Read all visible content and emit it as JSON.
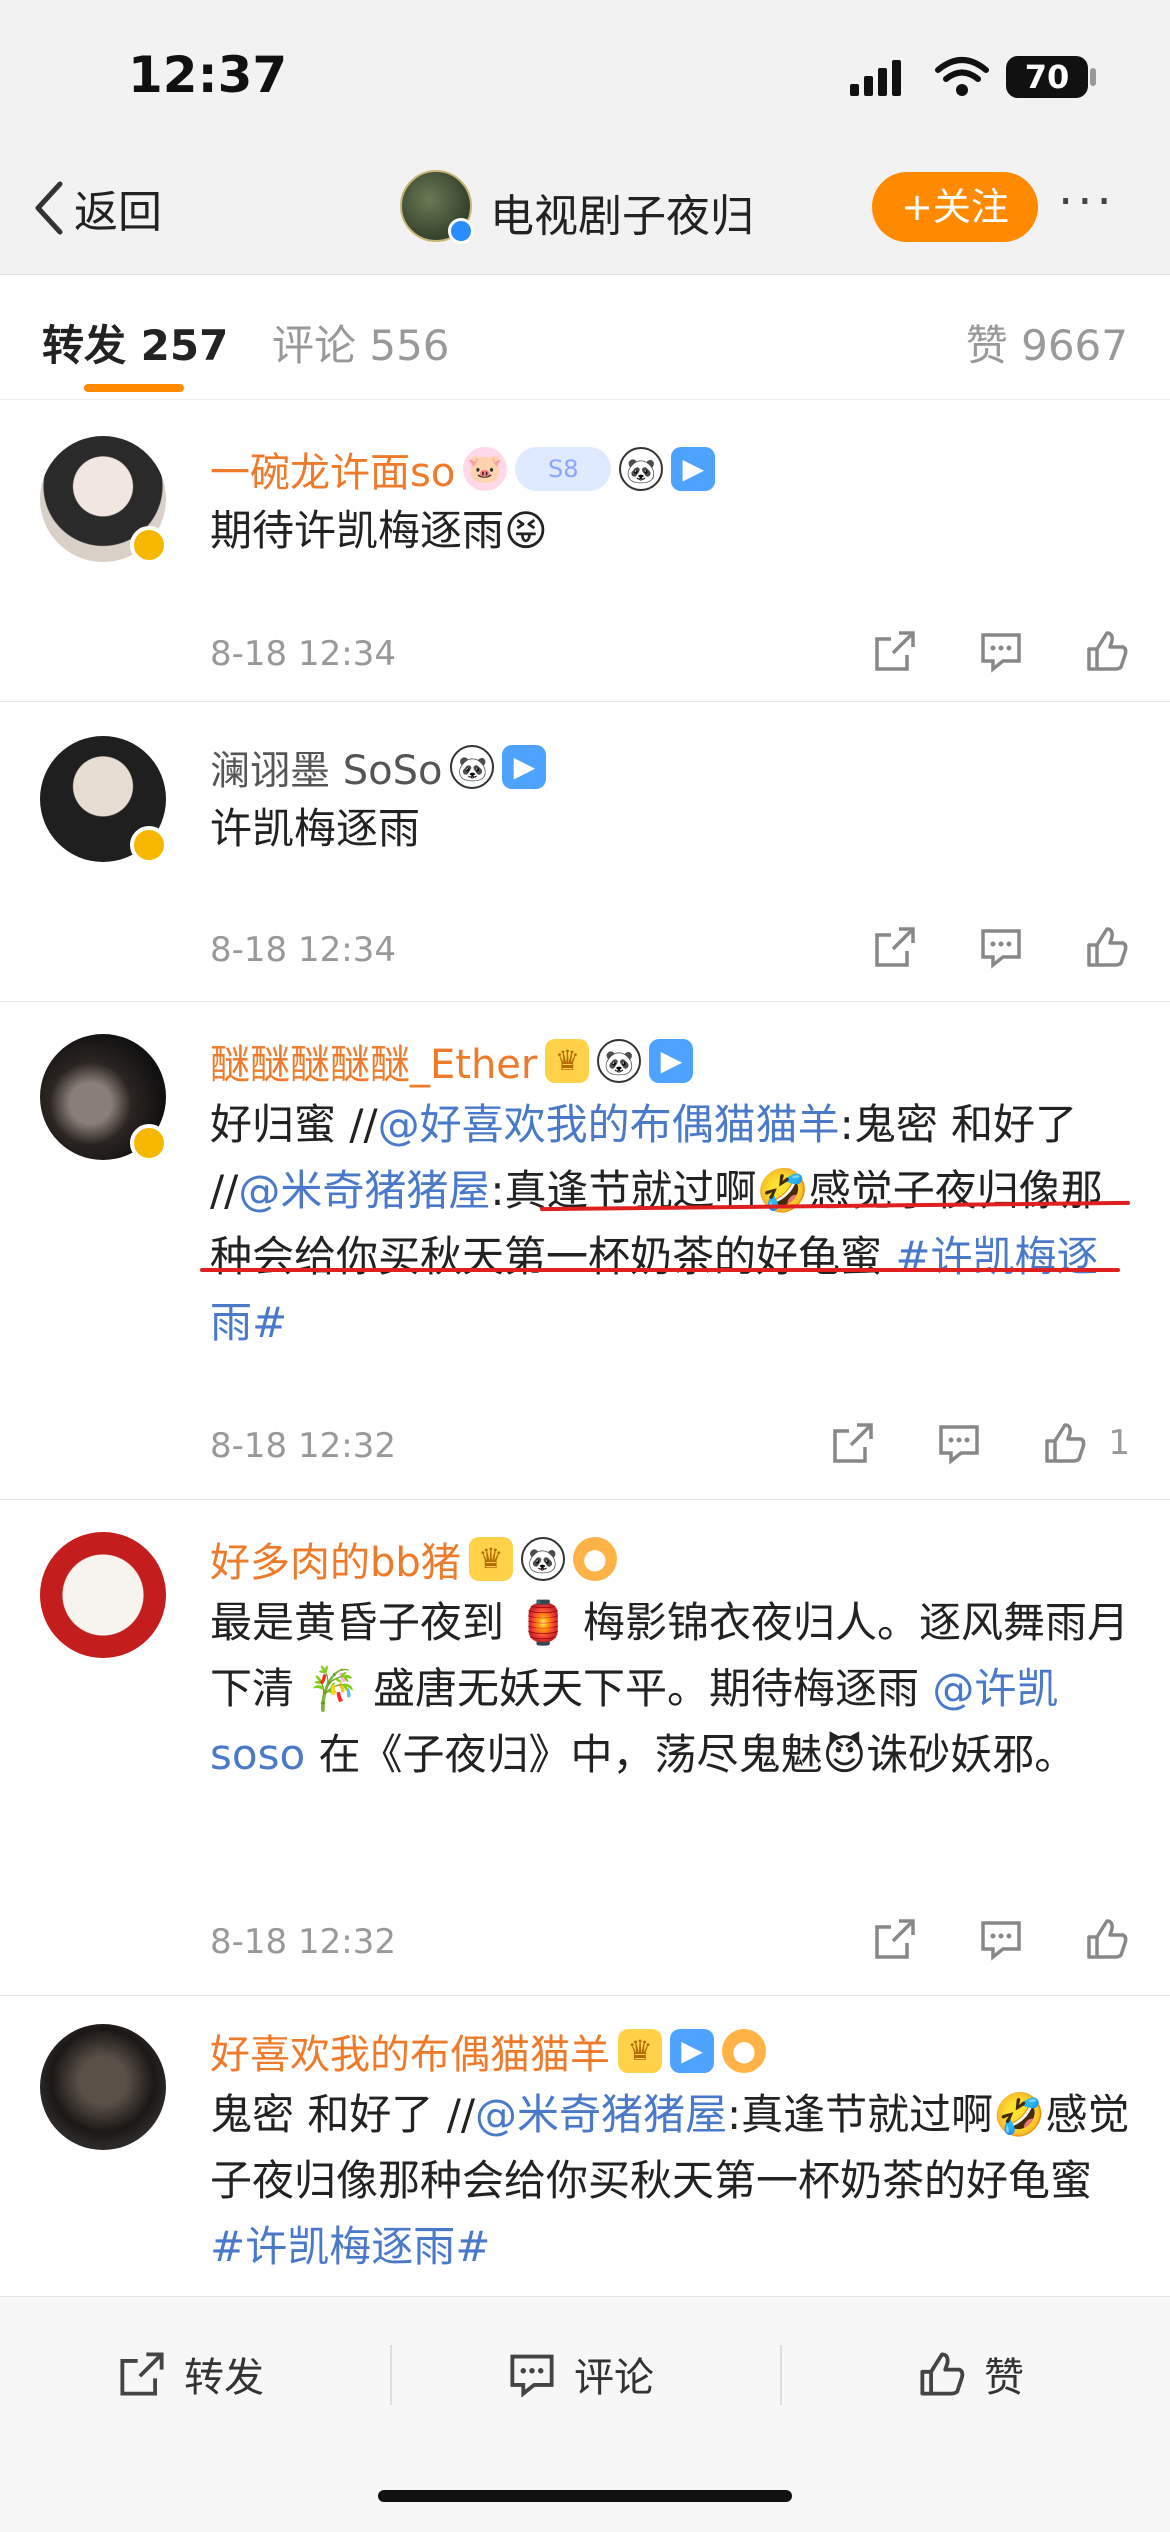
{
  "status": {
    "time": "12:37",
    "battery": "70"
  },
  "nav": {
    "back_label": "返回",
    "channel_name": "电视剧子夜归",
    "follow_label": "+关注",
    "more_label": "···"
  },
  "tabs": {
    "repost": "转发 257",
    "comment": "评论 556",
    "like": "赞 9667"
  },
  "posts": [
    {
      "user": "一碗龙许面so",
      "text": "期待许凯梅逐雨😝",
      "time": "8-18 12:34"
    },
    {
      "user": "澜诩墨 SoSo",
      "text": "许凯梅逐雨",
      "time": "8-18 12:34"
    },
    {
      "user": "醚醚醚醚醚_Ether",
      "text_a": "好归蜜 //",
      "mention1": "@好喜欢我的布偶猫猫羊",
      "text_b": ":鬼密 和好了 //",
      "mention2": "@米奇猪猪屋",
      "text_c": ":真逢节就过啊🤣感觉子夜归像那种会给你买秋天第一杯奶茶的好龟蜜 ",
      "topic": "#许凯梅逐雨#",
      "time": "8-18 12:32",
      "likes": "1"
    },
    {
      "user": "好多肉的bb猪",
      "text_a": "最是黄昏子夜到 🏮 梅影锦衣夜归人。逐风舞雨月下清 🎋 盛唐无妖天下平。期待梅逐雨 ",
      "mention": "@许凯 soso",
      "text_b": " 在《子夜归》中，荡尽鬼魅😈诛砂妖邪。",
      "time": "8-18 12:32"
    },
    {
      "user": "好喜欢我的布偶猫猫羊",
      "text_a": "鬼密 和好了 //",
      "mention": "@米奇猪猪屋",
      "text_b": ":真逢节就过啊🤣感觉子夜归像那种会给你买秋天第一杯奶茶的好龟蜜 ",
      "topic": "#许凯梅逐雨#"
    }
  ],
  "bottom": {
    "repost": "转发",
    "comment": "评论",
    "like": "赞"
  },
  "colors": {
    "accent": "#ff8a00",
    "mention": "#4a79c9",
    "username": "#ee7a2a",
    "underline": "#e02020"
  }
}
